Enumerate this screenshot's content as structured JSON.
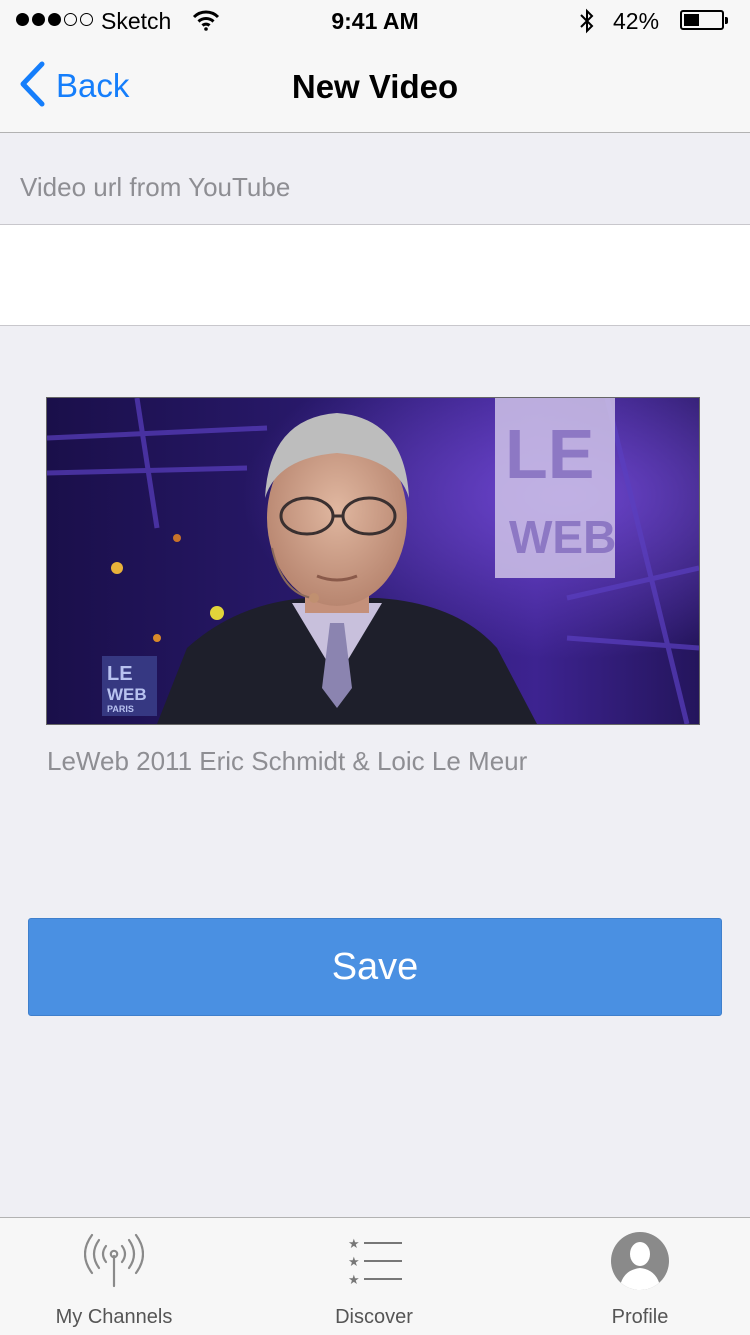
{
  "status_bar": {
    "signal_dots": [
      "full",
      "full",
      "full",
      "empty",
      "empty"
    ],
    "carrier": "Sketch",
    "time": "9:41 AM",
    "battery_percent": "42%",
    "battery_level": 0.42
  },
  "nav": {
    "back_label": "Back",
    "title": "New Video",
    "accent": "#157efb"
  },
  "form": {
    "section_label": "Video url from YouTube",
    "url_value": ""
  },
  "video": {
    "title": "LeWeb 2011 Eric Schmidt & Loic Le Meur",
    "logo_text": [
      "LE",
      "WEB"
    ],
    "badge_text": [
      "LE",
      "WEB",
      "PARIS"
    ]
  },
  "actions": {
    "save_label": "Save",
    "save_color": "#4a90e2"
  },
  "tabbar": {
    "items": [
      {
        "label": "My Channels",
        "icon": "broadcast-icon"
      },
      {
        "label": "Discover",
        "icon": "starred-list-icon"
      },
      {
        "label": "Profile",
        "icon": "profile-avatar-icon"
      }
    ]
  }
}
